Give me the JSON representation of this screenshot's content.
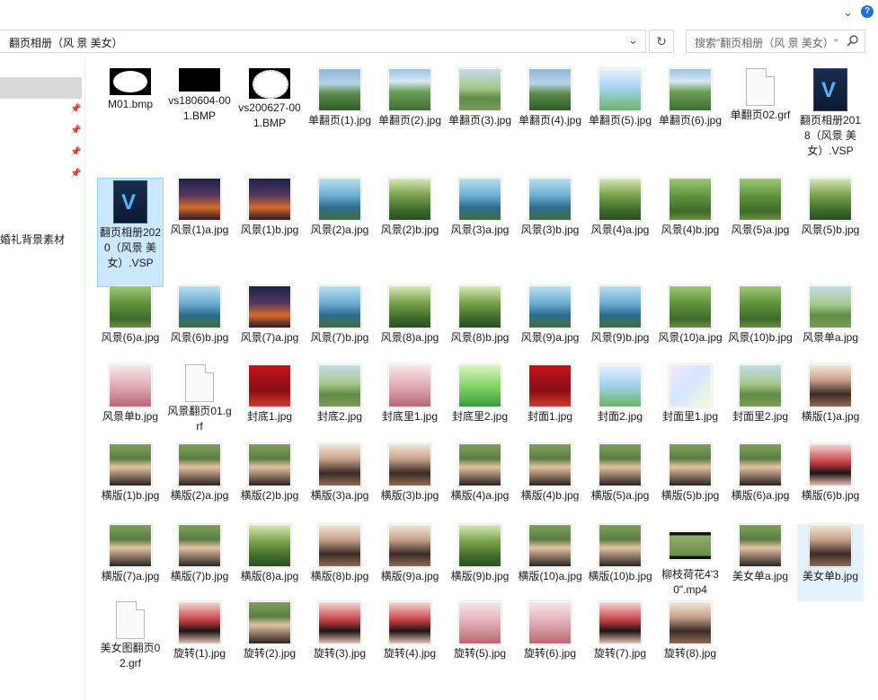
{
  "window": {
    "address_path": "翻页相册（风 景  美女）",
    "search_placeholder": "搜索\"翻页相册（风 景  美女）\""
  },
  "icons": {
    "address_dropdown": "chevron-down-icon",
    "refresh": "refresh-icon",
    "search": "search-icon",
    "help": "help-icon",
    "pin": "pin-icon"
  },
  "nav": {
    "folder_label": "婚礼背景素材"
  },
  "files": [
    {
      "name": "M01.bmp",
      "type": "mask-oval"
    },
    {
      "name": "vs180604-001.BMP",
      "type": "mask-black"
    },
    {
      "name": "vs200627-001.BMP",
      "type": "mask-lace"
    },
    {
      "name": "单翻页(1).jpg",
      "type": "img",
      "style": "land"
    },
    {
      "name": "单翻页(2).jpg",
      "type": "img",
      "style": "land2"
    },
    {
      "name": "单翻页(3).jpg",
      "type": "img",
      "style": "land3"
    },
    {
      "name": "单翻页(4).jpg",
      "type": "img",
      "style": "land"
    },
    {
      "name": "单翻页(5).jpg",
      "type": "img",
      "style": "sky"
    },
    {
      "name": "单翻页(6).jpg",
      "type": "img",
      "style": "land2"
    },
    {
      "name": "单翻页02.grf",
      "type": "doc"
    },
    {
      "name": "翻页相册2018（风景 美女）.VSP",
      "type": "vsp"
    },
    {
      "name": "翻页相册2020（风景 美女）.VSP",
      "type": "vsp",
      "state": "selected"
    },
    {
      "name": "风景(1)a.jpg",
      "type": "img",
      "style": "night"
    },
    {
      "name": "风景(1)b.jpg",
      "type": "img",
      "style": "night"
    },
    {
      "name": "风景(2)a.jpg",
      "type": "img",
      "style": "lake"
    },
    {
      "name": "风景(2)b.jpg",
      "type": "img",
      "style": "forest"
    },
    {
      "name": "风景(3)a.jpg",
      "type": "img",
      "style": "lake"
    },
    {
      "name": "风景(3)b.jpg",
      "type": "img",
      "style": "lake"
    },
    {
      "name": "风景(4)a.jpg",
      "type": "img",
      "style": "forest"
    },
    {
      "name": "风景(4)b.jpg",
      "type": "img",
      "style": "garden"
    },
    {
      "name": "风景(5)a.jpg",
      "type": "img",
      "style": "garden"
    },
    {
      "name": "风景(5)b.jpg",
      "type": "img",
      "style": "forest"
    },
    {
      "name": "风景(6)a.jpg",
      "type": "img",
      "style": "garden"
    },
    {
      "name": "风景(6)b.jpg",
      "type": "img",
      "style": "lake"
    },
    {
      "name": "风景(7)a.jpg",
      "type": "img",
      "style": "night"
    },
    {
      "name": "风景(7)b.jpg",
      "type": "img",
      "style": "lake"
    },
    {
      "name": "风景(8)a.jpg",
      "type": "img",
      "style": "forest"
    },
    {
      "name": "风景(8)b.jpg",
      "type": "img",
      "style": "forest"
    },
    {
      "name": "风景(9)a.jpg",
      "type": "img",
      "style": "lake"
    },
    {
      "name": "风景(9)b.jpg",
      "type": "img",
      "style": "lake"
    },
    {
      "name": "风景(10)a.jpg",
      "type": "img",
      "style": "garden"
    },
    {
      "name": "风景(10)b.jpg",
      "type": "img",
      "style": "garden"
    },
    {
      "name": "风景单a.jpg",
      "type": "img",
      "style": "land3"
    },
    {
      "name": "风景单b.jpg",
      "type": "img",
      "style": "pink"
    },
    {
      "name": "风景翻页01.grf",
      "type": "doc"
    },
    {
      "name": "封底1.jpg",
      "type": "img",
      "style": "red"
    },
    {
      "name": "封底2.jpg",
      "type": "img",
      "style": "land3"
    },
    {
      "name": "封底里1.jpg",
      "type": "img",
      "style": "pink"
    },
    {
      "name": "封底里2.jpg",
      "type": "img",
      "style": "green"
    },
    {
      "name": "封面1.jpg",
      "type": "img",
      "style": "red"
    },
    {
      "name": "封面2.jpg",
      "type": "img",
      "style": "sky"
    },
    {
      "name": "封面里1.jpg",
      "type": "img",
      "style": "pastel"
    },
    {
      "name": "封面里2.jpg",
      "type": "img",
      "style": "land3"
    },
    {
      "name": "横版(1)a.jpg",
      "type": "img",
      "style": "portrait2"
    },
    {
      "name": "横版(1)b.jpg",
      "type": "img",
      "style": "portrait"
    },
    {
      "name": "横版(2)a.jpg",
      "type": "img",
      "style": "portrait"
    },
    {
      "name": "横版(2)b.jpg",
      "type": "img",
      "style": "portrait"
    },
    {
      "name": "横版(3)a.jpg",
      "type": "img",
      "style": "portrait2"
    },
    {
      "name": "横版(3)b.jpg",
      "type": "img",
      "style": "portrait2"
    },
    {
      "name": "横版(4)a.jpg",
      "type": "img",
      "style": "portrait"
    },
    {
      "name": "横版(4)b.jpg",
      "type": "img",
      "style": "portrait"
    },
    {
      "name": "横版(5)a.jpg",
      "type": "img",
      "style": "portrait"
    },
    {
      "name": "横版(5)b.jpg",
      "type": "img",
      "style": "portrait"
    },
    {
      "name": "横版(6)a.jpg",
      "type": "img",
      "style": "portrait"
    },
    {
      "name": "横版(6)b.jpg",
      "type": "img",
      "style": "hanfu"
    },
    {
      "name": "横版(7)a.jpg",
      "type": "img",
      "style": "portrait"
    },
    {
      "name": "横版(7)b.jpg",
      "type": "img",
      "style": "portrait"
    },
    {
      "name": "横版(8)a.jpg",
      "type": "img",
      "style": "forest"
    },
    {
      "name": "横版(8)b.jpg",
      "type": "img",
      "style": "portrait2"
    },
    {
      "name": "横版(9)a.jpg",
      "type": "img",
      "style": "portrait2"
    },
    {
      "name": "横版(9)b.jpg",
      "type": "img",
      "style": "forest"
    },
    {
      "name": "横版(10)a.jpg",
      "type": "img",
      "style": "portrait"
    },
    {
      "name": "横版(10)b.jpg",
      "type": "img",
      "style": "portrait"
    },
    {
      "name": "柳枝荷花4'30\".mp4",
      "type": "video"
    },
    {
      "name": "美女单a.jpg",
      "type": "img",
      "style": "portrait"
    },
    {
      "name": "美女单b.jpg",
      "type": "img",
      "style": "portrait2",
      "state": "hover"
    },
    {
      "name": "美女图翻页02.grf",
      "type": "doc"
    },
    {
      "name": "旋转(1).jpg",
      "type": "img",
      "style": "hanfu"
    },
    {
      "name": "旋转(2).jpg",
      "type": "img",
      "style": "portrait"
    },
    {
      "name": "旋转(3).jpg",
      "type": "img",
      "style": "hanfu"
    },
    {
      "name": "旋转(4).jpg",
      "type": "img",
      "style": "hanfu"
    },
    {
      "name": "旋转(5).jpg",
      "type": "img",
      "style": "pink"
    },
    {
      "name": "旋转(6).jpg",
      "type": "img",
      "style": "pink"
    },
    {
      "name": "旋转(7).jpg",
      "type": "img",
      "style": "hanfu"
    },
    {
      "name": "旋转(8).jpg",
      "type": "img",
      "style": "portrait2"
    }
  ]
}
